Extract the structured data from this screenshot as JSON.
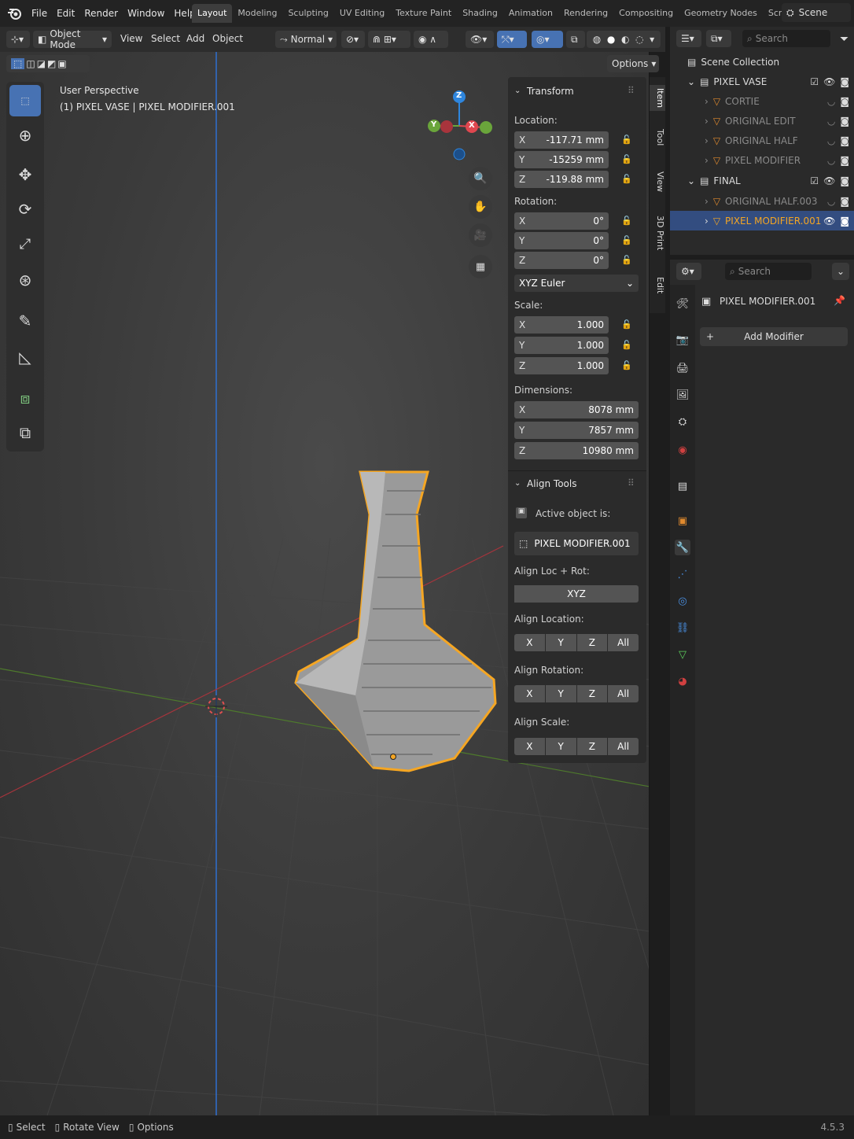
{
  "menu": [
    "File",
    "Edit",
    "Render",
    "Window",
    "Help"
  ],
  "workspaces": [
    "Layout",
    "Modeling",
    "Sculpting",
    "UV Editing",
    "Texture Paint",
    "Shading",
    "Animation",
    "Rendering",
    "Compositing",
    "Geometry Nodes",
    "Scripting"
  ],
  "active_workspace": "Layout",
  "scene_name": "Scene",
  "header": {
    "mode": "Object Mode",
    "menus": [
      "View",
      "Select",
      "Add",
      "Object"
    ],
    "orientation": "Normal",
    "options": "Options"
  },
  "viewport": {
    "title": "User Perspective",
    "subtitle": "(1) PIXEL VASE | PIXEL MODIFIER.001",
    "gizmo": {
      "x": "X",
      "y": "Y",
      "z": "Z"
    }
  },
  "transform": {
    "title": "Transform",
    "location_label": "Location:",
    "location": [
      {
        "axis": "X",
        "value": "-117.71 mm"
      },
      {
        "axis": "Y",
        "value": "-15259 mm"
      },
      {
        "axis": "Z",
        "value": "-119.88 mm"
      }
    ],
    "rotation_label": "Rotation:",
    "rotation": [
      {
        "axis": "X",
        "value": "0°"
      },
      {
        "axis": "Y",
        "value": "0°"
      },
      {
        "axis": "Z",
        "value": "0°"
      }
    ],
    "rotation_mode": "XYZ Euler",
    "scale_label": "Scale:",
    "scale": [
      {
        "axis": "X",
        "value": "1.000"
      },
      {
        "axis": "Y",
        "value": "1.000"
      },
      {
        "axis": "Z",
        "value": "1.000"
      }
    ],
    "dimensions_label": "Dimensions:",
    "dimensions": [
      {
        "axis": "X",
        "value": "8078 mm"
      },
      {
        "axis": "Y",
        "value": "7857 mm"
      },
      {
        "axis": "Z",
        "value": "10980 mm"
      }
    ]
  },
  "align": {
    "title": "Align Tools",
    "active_label": "Active object is:",
    "active_object": "PIXEL MODIFIER.001",
    "locrot_label": "Align Loc + Rot:",
    "locrot_btn": "XYZ",
    "location_label": "Align Location:",
    "rotation_label": "Align Rotation:",
    "scale_label": "Align Scale:",
    "axes": [
      "X",
      "Y",
      "Z",
      "All"
    ]
  },
  "npanel_tabs": [
    "Item",
    "Tool",
    "View",
    "3D Print",
    "Edit"
  ],
  "outliner": {
    "search_placeholder": "Search",
    "root": "Scene Collection",
    "rows": [
      {
        "name": "PIXEL VASE",
        "type": "collection"
      },
      {
        "name": "CORTIE",
        "type": "object"
      },
      {
        "name": "ORIGINAL EDIT",
        "type": "object"
      },
      {
        "name": "ORIGINAL HALF",
        "type": "object"
      },
      {
        "name": "PIXEL MODIFIER",
        "type": "object"
      },
      {
        "name": "FINAL",
        "type": "collection"
      },
      {
        "name": "ORIGINAL HALF.003",
        "type": "object"
      },
      {
        "name": "PIXEL MODIFIER.001",
        "type": "object",
        "selected": true
      }
    ]
  },
  "properties": {
    "search_placeholder": "Search",
    "object_name": "PIXEL MODIFIER.001",
    "add_modifier": "Add Modifier"
  },
  "status": {
    "select": "Select",
    "rotate": "Rotate View",
    "options": "Options",
    "version": "4.5.3"
  },
  "colors": {
    "accent": "#4772b3",
    "selection": "#f5a623",
    "x_axis": "#e0474f",
    "y_axis": "#6aa53b",
    "z_axis": "#2e86de"
  }
}
